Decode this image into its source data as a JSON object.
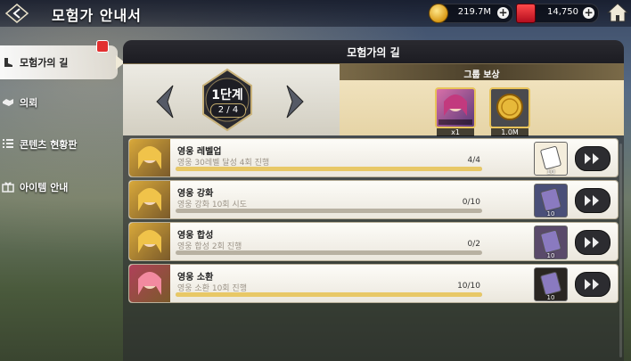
{
  "header": {
    "title": "모험가 안내서"
  },
  "currency": {
    "gold": "219.7M",
    "gems": "14,750"
  },
  "nav": [
    {
      "label": "모험가의 길",
      "active": true
    },
    {
      "label": "의뢰"
    },
    {
      "label": "콘텐츠 현황판"
    },
    {
      "label": "아이템 안내"
    }
  ],
  "panel": {
    "title": "모험가의 길",
    "stage": {
      "name": "1단계",
      "progress": "2 / 4"
    },
    "group_reward": {
      "title": "그룹 보상",
      "items": [
        {
          "icon": "hero-portrait-icon",
          "count": "x1"
        },
        {
          "icon": "gold-coin-icon",
          "count": "1.0M"
        }
      ]
    },
    "missions": [
      {
        "title": "영웅 레벨업",
        "desc": "영웅 30레벨 달성 4회 진행",
        "count": "4/4",
        "progress": 1.0,
        "reward_count": "10",
        "reward_color": "#f4eddc"
      },
      {
        "title": "영웅 강화",
        "desc": "영웅 강화 10회 시도",
        "count": "0/10",
        "progress": 0.0,
        "reward_count": "10",
        "reward_color": "#4a4f78"
      },
      {
        "title": "영웅 합성",
        "desc": "영웅 합성 2회 진행",
        "count": "0/2",
        "progress": 0.0,
        "reward_count": "10",
        "reward_color": "#5a4a6a"
      },
      {
        "title": "영웅 소환",
        "desc": "영웅 소환 10회 진행",
        "count": "10/10",
        "progress": 1.0,
        "reward_count": "10",
        "reward_color": "#2a2622"
      }
    ]
  },
  "colors": {
    "accent_gold": "#e8c866",
    "panel_dark": "#1c1c22"
  }
}
